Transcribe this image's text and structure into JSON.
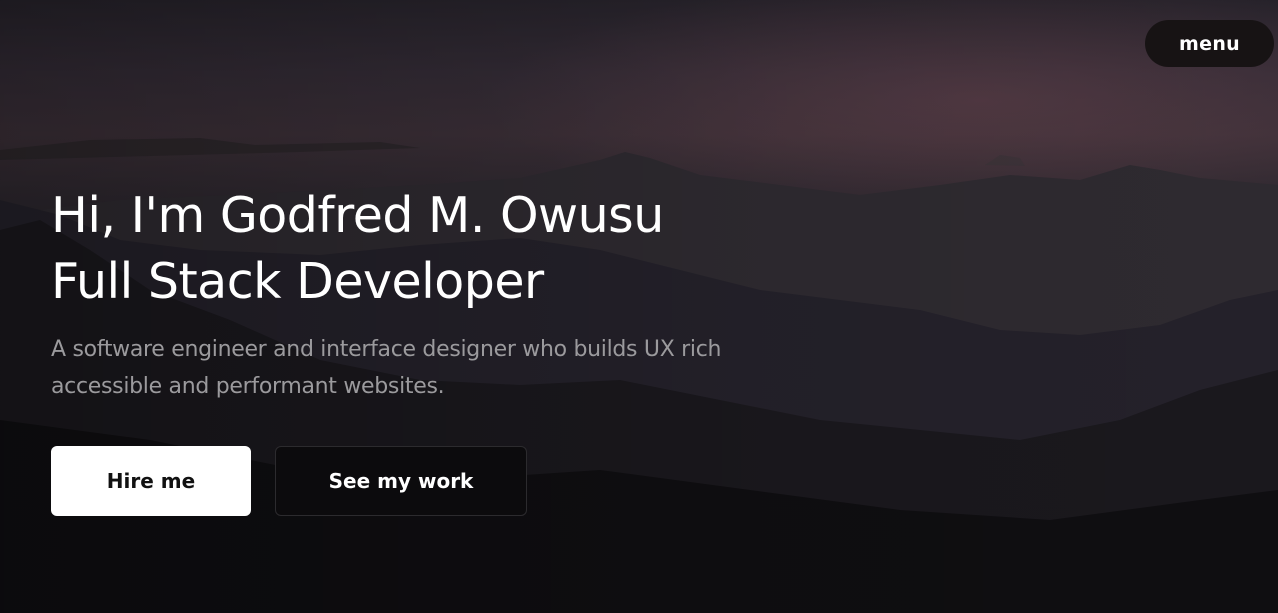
{
  "header": {
    "menu_label": "menu"
  },
  "hero": {
    "headline_line1": "Hi, I'm Godfred M. Owusu",
    "headline_line2": "Full Stack Developer",
    "subtitle": "A software engineer and interface designer who builds UX rich accessible and performant websites.",
    "primary_action": "Hire me",
    "secondary_action": "See my work"
  },
  "colors": {
    "background": "#0b0a0c",
    "text_primary": "#ffffff",
    "text_muted": "#9b9a9d",
    "button_primary_bg": "#ffffff",
    "button_secondary_bg": "#0c0b0d",
    "menu_bg": "#171314"
  }
}
